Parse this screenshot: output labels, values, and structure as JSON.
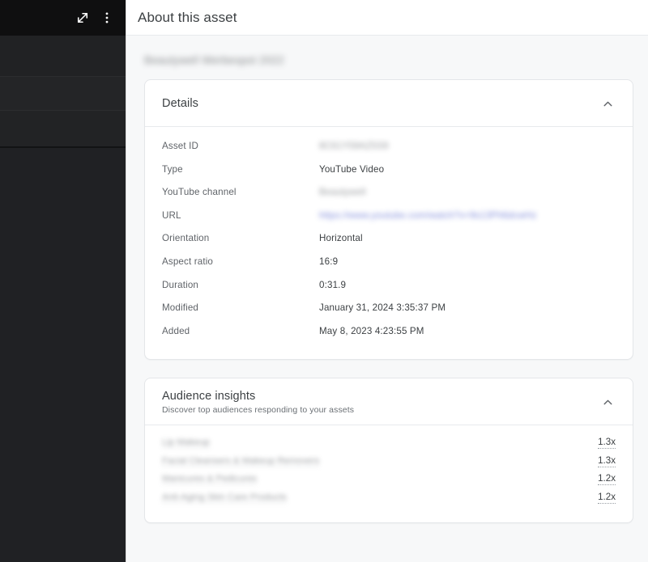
{
  "left_panel": {
    "expand_icon": "expand-diagonal-icon",
    "more_icon": "more-vert-icon"
  },
  "header": {
    "title": "About this asset"
  },
  "asset": {
    "name": "Beautywell Werbespot 2022"
  },
  "details_card": {
    "title": "Details",
    "collapse_icon": "chevron-up-icon",
    "rows": [
      {
        "label": "Asset ID",
        "value": "8C61Y59AZ5S9",
        "style": "redacted"
      },
      {
        "label": "Type",
        "value": "YouTube Video",
        "style": "plain"
      },
      {
        "label": "YouTube channel",
        "value": "Beautywell",
        "style": "redacted"
      },
      {
        "label": "URL",
        "value": "https://www.youtube.com/watch?v=9s13Ph6dcwHz",
        "style": "link"
      },
      {
        "label": "Orientation",
        "value": "Horizontal",
        "style": "plain"
      },
      {
        "label": "Aspect ratio",
        "value": "16:9",
        "style": "plain"
      },
      {
        "label": "Duration",
        "value": "0:31.9",
        "style": "plain"
      },
      {
        "label": "Modified",
        "value": "January 31, 2024 3:35:37 PM",
        "style": "plain"
      },
      {
        "label": "Added",
        "value": "May 8, 2023 4:23:55 PM",
        "style": "plain"
      }
    ]
  },
  "audience_card": {
    "title": "Audience insights",
    "subtitle": "Discover top audiences responding to your assets",
    "collapse_icon": "chevron-up-icon",
    "rows": [
      {
        "name": "Lip Makeup",
        "value": "1.3x"
      },
      {
        "name": "Facial Cleansers & Makeup Removers",
        "value": "1.3x"
      },
      {
        "name": "Manicures & Pedicures",
        "value": "1.2x"
      },
      {
        "name": "Anti-Aging Skin Care Products",
        "value": "1.2x"
      }
    ]
  },
  "colors": {
    "panel_dark": "#202124",
    "panel_topbar": "#0f0f10",
    "page_bg": "#f7f8f9",
    "card_bg": "#ffffff",
    "text_primary": "#3c4043",
    "text_secondary": "#5f6368",
    "link": "#5b6bd0",
    "border": "#e8eaed"
  }
}
